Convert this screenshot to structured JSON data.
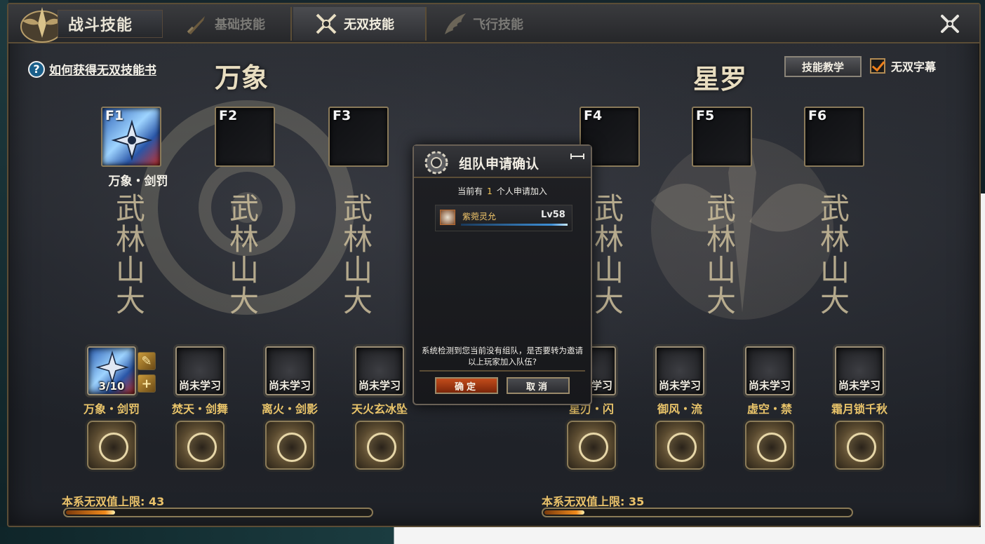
{
  "window": {
    "title": "战斗技能",
    "close_icon": "crossed-swords-close-icon"
  },
  "tabs": [
    {
      "label": "基础技能",
      "icon": "sword-icon",
      "active": false
    },
    {
      "label": "无双技能",
      "icon": "crossed-blades-icon",
      "active": true
    },
    {
      "label": "飞行技能",
      "icon": "wing-icon",
      "active": false
    }
  ],
  "help": {
    "text": "如何获得无双技能书",
    "icon": "question-icon"
  },
  "schools": {
    "left": "万象",
    "right": "星罗"
  },
  "controls": {
    "teach_label": "技能教学",
    "checkbox_label": "无双字幕",
    "checkbox_checked": true
  },
  "hotkeys": [
    {
      "key": "F1",
      "filled": true,
      "name": "万象・剑罚"
    },
    {
      "key": "F2",
      "filled": false
    },
    {
      "key": "F3",
      "filled": false
    },
    {
      "key": "F4",
      "filled": false
    },
    {
      "key": "F5",
      "filled": false
    },
    {
      "key": "F6",
      "filled": false
    }
  ],
  "calligraphy_columns": [
    "武林山大",
    "武林山大",
    "武林山大",
    "武林山大",
    "武林山大",
    "武林山大"
  ],
  "skills_left": [
    {
      "name": "万象・剑罚",
      "state": "3/10",
      "learned": true
    },
    {
      "name": "焚天・剑舞",
      "state": "尚未学习",
      "learned": false
    },
    {
      "name": "离火・剑影",
      "state": "尚未学习",
      "learned": false
    },
    {
      "name": "天火玄冰坠",
      "state": "尚未学习",
      "learned": false
    }
  ],
  "skills_right": [
    {
      "name": "星刃・闪",
      "state": "尚未学习",
      "learned": false
    },
    {
      "name": "御风・流",
      "state": "尚未学习",
      "learned": false
    },
    {
      "name": "虚空・禁",
      "state": "尚未学习",
      "learned": false
    },
    {
      "name": "霜月锁千秋",
      "state": "尚未学习",
      "learned": false
    }
  ],
  "limits": {
    "left": {
      "label": "本系无双值上限: 43",
      "fill_fraction": 0.16
    },
    "right": {
      "label": "本系无双值上限: 35",
      "fill_fraction": 0.13
    }
  },
  "dialog": {
    "title": "组队申请确认",
    "info_prefix": "当前有",
    "info_count": "1",
    "info_suffix": "个人申请加入",
    "applicant": {
      "name": "紫菀灵允",
      "level": "Lv58"
    },
    "message": "系统检测到您当前没有组队，是否要转为邀请以上玩家加入队伍?",
    "ok_label": "确定",
    "cancel_label": "取消"
  }
}
